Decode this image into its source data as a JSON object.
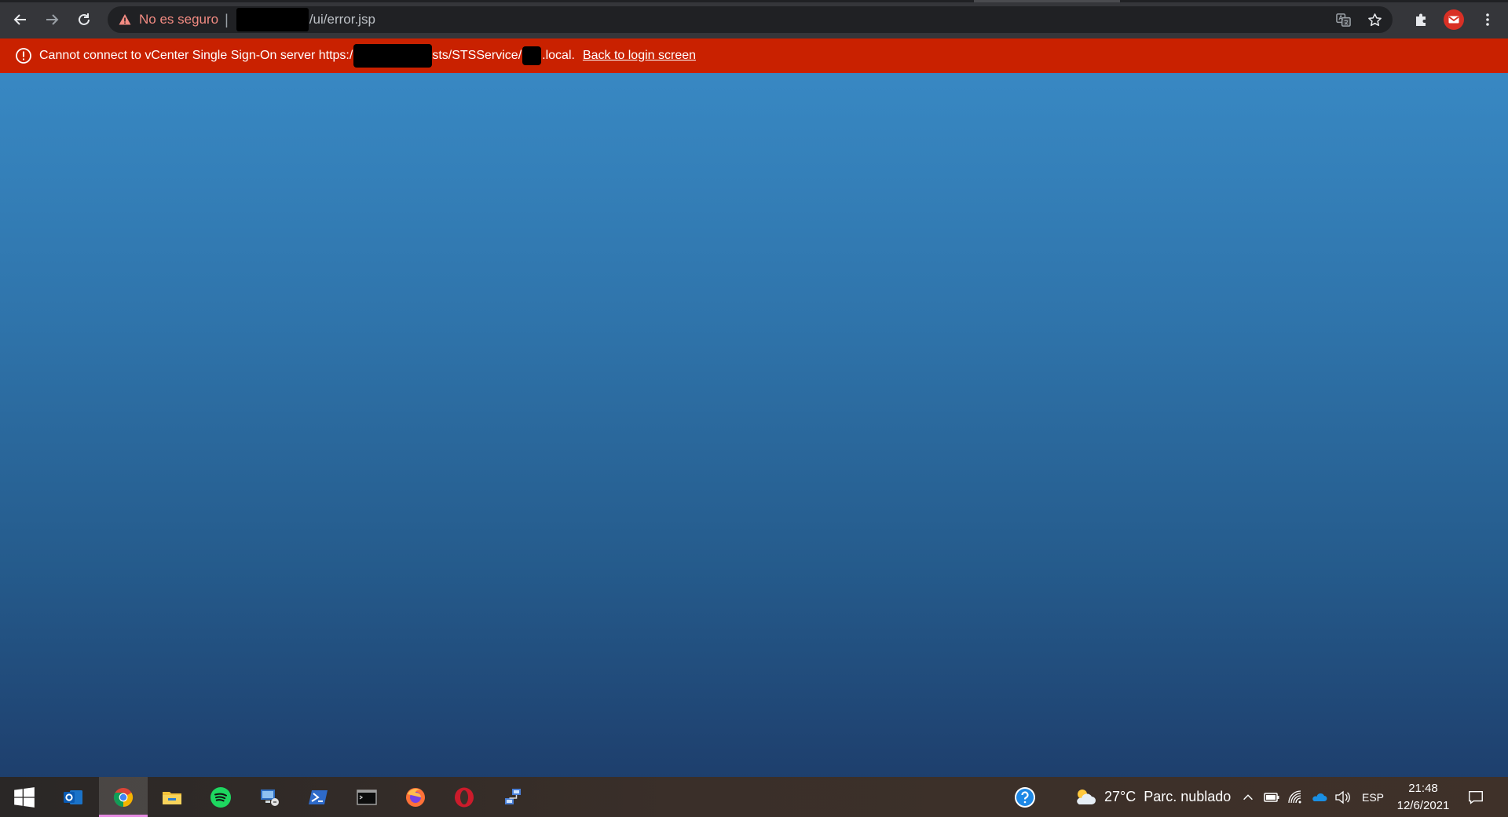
{
  "browser": {
    "address_bar": {
      "security_label": "No es seguro",
      "separator": "|",
      "url_path": "/ui/error.jsp"
    },
    "icons": {
      "back": "back-arrow-icon",
      "forward": "forward-arrow-icon",
      "reload": "reload-icon",
      "warning": "warning-triangle-icon",
      "translate": "translate-icon",
      "bookmark": "star-icon",
      "extensions": "puzzle-icon",
      "profile": "gmail-avatar-icon",
      "menu": "kebab-menu-icon"
    }
  },
  "error_banner": {
    "message_part1": "Cannot connect to vCenter Single Sign-On server https:/",
    "message_part2": "sts/STSService/",
    "message_part3": ".local.",
    "link_label": "Back to login screen",
    "color": "#c92100"
  },
  "taskbar": {
    "apps": [
      "start",
      "outlook",
      "chrome",
      "file-explorer",
      "spotify",
      "remote-desktop-manager",
      "powershell",
      "terminal",
      "firefox",
      "opera",
      "network"
    ],
    "weather": {
      "temp": "27°C",
      "condition": "Parc. nublado"
    },
    "language": "ESP",
    "time": "21:48",
    "date": "12/6/2021"
  }
}
